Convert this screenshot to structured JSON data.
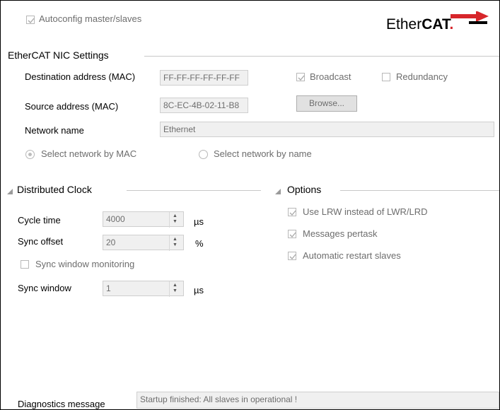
{
  "header": {
    "autoconfig_label": "Autoconfig master/slaves",
    "autoconfig_checked": true,
    "logo_text_plain": "Ether",
    "logo_text_bold": "CAT",
    "logo_mark": "."
  },
  "nic": {
    "title": "EtherCAT NIC Settings",
    "dest_label": "Destination address (MAC)",
    "dest_value": "FF-FF-FF-FF-FF-FF",
    "broadcast_label": "Broadcast",
    "broadcast_checked": true,
    "redundancy_label": "Redundancy",
    "redundancy_checked": false,
    "source_label": "Source address (MAC)",
    "source_value": "8C-EC-4B-02-11-B8",
    "browse_label": "Browse...",
    "network_label": "Network name",
    "network_value": "Ethernet",
    "radio_mac_label": "Select network by MAC",
    "radio_name_label": "Select network by name",
    "selected_radio": "mac"
  },
  "clock": {
    "title": "Distributed Clock",
    "cycle_label": "Cycle time",
    "cycle_value": "4000",
    "cycle_unit": "µs",
    "offset_label": "Sync offset",
    "offset_value": "20",
    "offset_unit": "%",
    "window_monitoring_label": "Sync window monitoring",
    "window_monitoring_checked": false,
    "window_label": "Sync window",
    "window_value": "1",
    "window_unit": "µs"
  },
  "options": {
    "title": "Options",
    "items": [
      {
        "label": "Use LRW instead of LWR/LRD",
        "checked": true
      },
      {
        "label": "Messages pertask",
        "checked": true
      },
      {
        "label": "Automatic restart slaves",
        "checked": true
      }
    ]
  },
  "diagnostics": {
    "label": "Diagnostics message",
    "value": "Startup finished: All slaves in operational !"
  },
  "colors": {
    "logo_red": "#d7262b",
    "disabled_text": "#6d6d6d",
    "field_bg": "#f0f0f0"
  }
}
